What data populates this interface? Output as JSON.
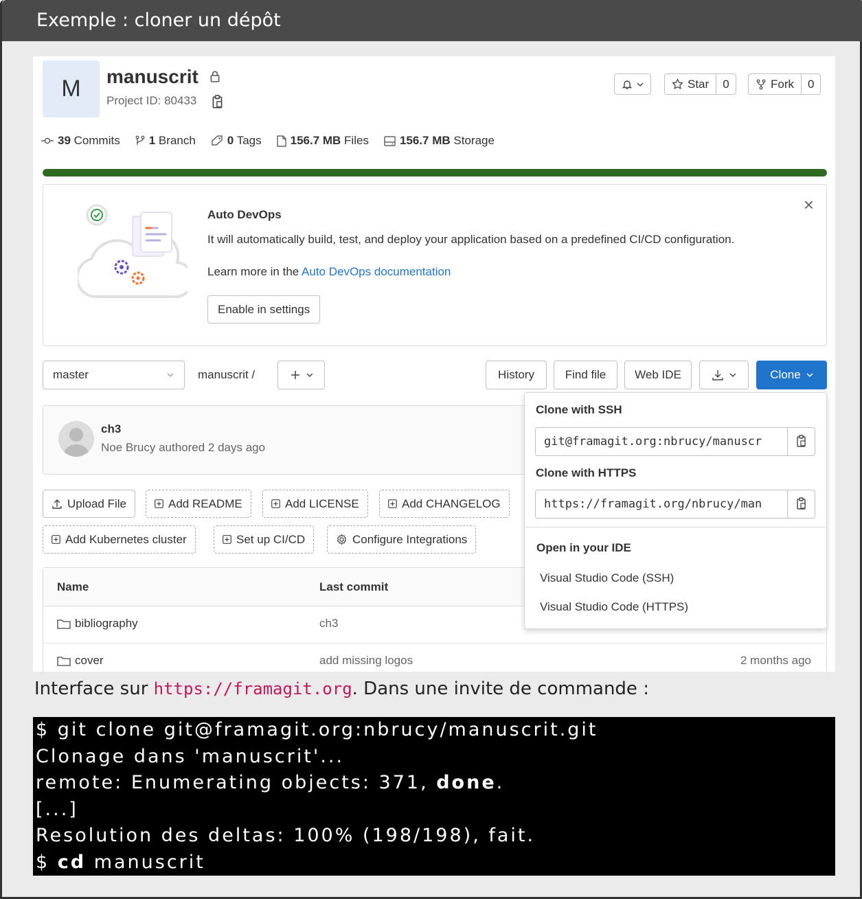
{
  "frame_title": "Exemple : cloner un dépôt",
  "project": {
    "avatar_letter": "M",
    "name": "manuscrit",
    "id_text": "Project ID: 80433"
  },
  "header_buttons": {
    "star_label": "Star",
    "star_count": "0",
    "fork_label": "Fork",
    "fork_count": "0"
  },
  "stats": {
    "commits_num": "39",
    "commits_label": "Commits",
    "branch_num": "1",
    "branch_label": "Branch",
    "tags_num": "0",
    "tags_label": "Tags",
    "files_num": "156.7 MB",
    "files_label": "Files",
    "storage_num": "156.7 MB",
    "storage_label": "Storage",
    "storage_fraction": 1.0
  },
  "devops": {
    "title": "Auto DevOps",
    "description": "It will automatically build, test, and deploy your application based on a predefined CI/CD configuration.",
    "learn_prefix": "Learn more in the ",
    "learn_link": "Auto DevOps documentation",
    "enable_button": "Enable in settings"
  },
  "toolbar": {
    "branch": "master",
    "breadcrumb": "manuscrit  /",
    "history": "History",
    "find_file": "Find file",
    "web_ide": "Web IDE",
    "clone": "Clone"
  },
  "last_commit": {
    "title": "ch3",
    "meta": "Noe Brucy authored 2 days ago"
  },
  "actions": {
    "upload": "Upload File",
    "readme": "Add README",
    "license": "Add LICENSE",
    "changelog": "Add CHANGELOG",
    "kubernetes": "Add Kubernetes cluster",
    "cicd": "Set up CI/CD",
    "integrations": "Configure Integrations"
  },
  "table": {
    "col_name": "Name",
    "col_last_commit": "Last commit",
    "rows": [
      {
        "name": "bibliography",
        "last_commit": "ch3",
        "updated": ""
      },
      {
        "name": "cover",
        "last_commit": "add missing logos",
        "updated": "2 months ago"
      }
    ]
  },
  "clone_dropdown": {
    "ssh_label": "Clone with SSH",
    "ssh_url": "git@framagit.org:nbrucy/manuscr",
    "https_label": "Clone with HTTPS",
    "https_url": "https://framagit.org/nbrucy/man",
    "ide_label": "Open in your IDE",
    "ide_ssh": "Visual Studio Code (SSH)",
    "ide_https": "Visual Studio Code (HTTPS)"
  },
  "caption": {
    "prefix": "Interface sur ",
    "url": "https://framagit.org",
    "suffix": ". Dans une invite de commande :"
  },
  "terminal": {
    "line1": "$ git clone git@framagit.org:nbrucy/manuscrit.git",
    "line2": "Clonage dans 'manuscrit'...",
    "line3_prefix": "remote: Enumerating objects: 371, ",
    "line3_bold": "done",
    "line3_suffix": ".",
    "line4": "[...]",
    "line5": "Resolution des deltas: 100% (198/198), fait.",
    "line6_prefix": "$ ",
    "line6_bold": "cd",
    "line6_suffix": " manuscrit"
  },
  "colors": {
    "accent": "#1f75cb",
    "progress": "#2e6b20",
    "caption_url": "#c2185b"
  }
}
